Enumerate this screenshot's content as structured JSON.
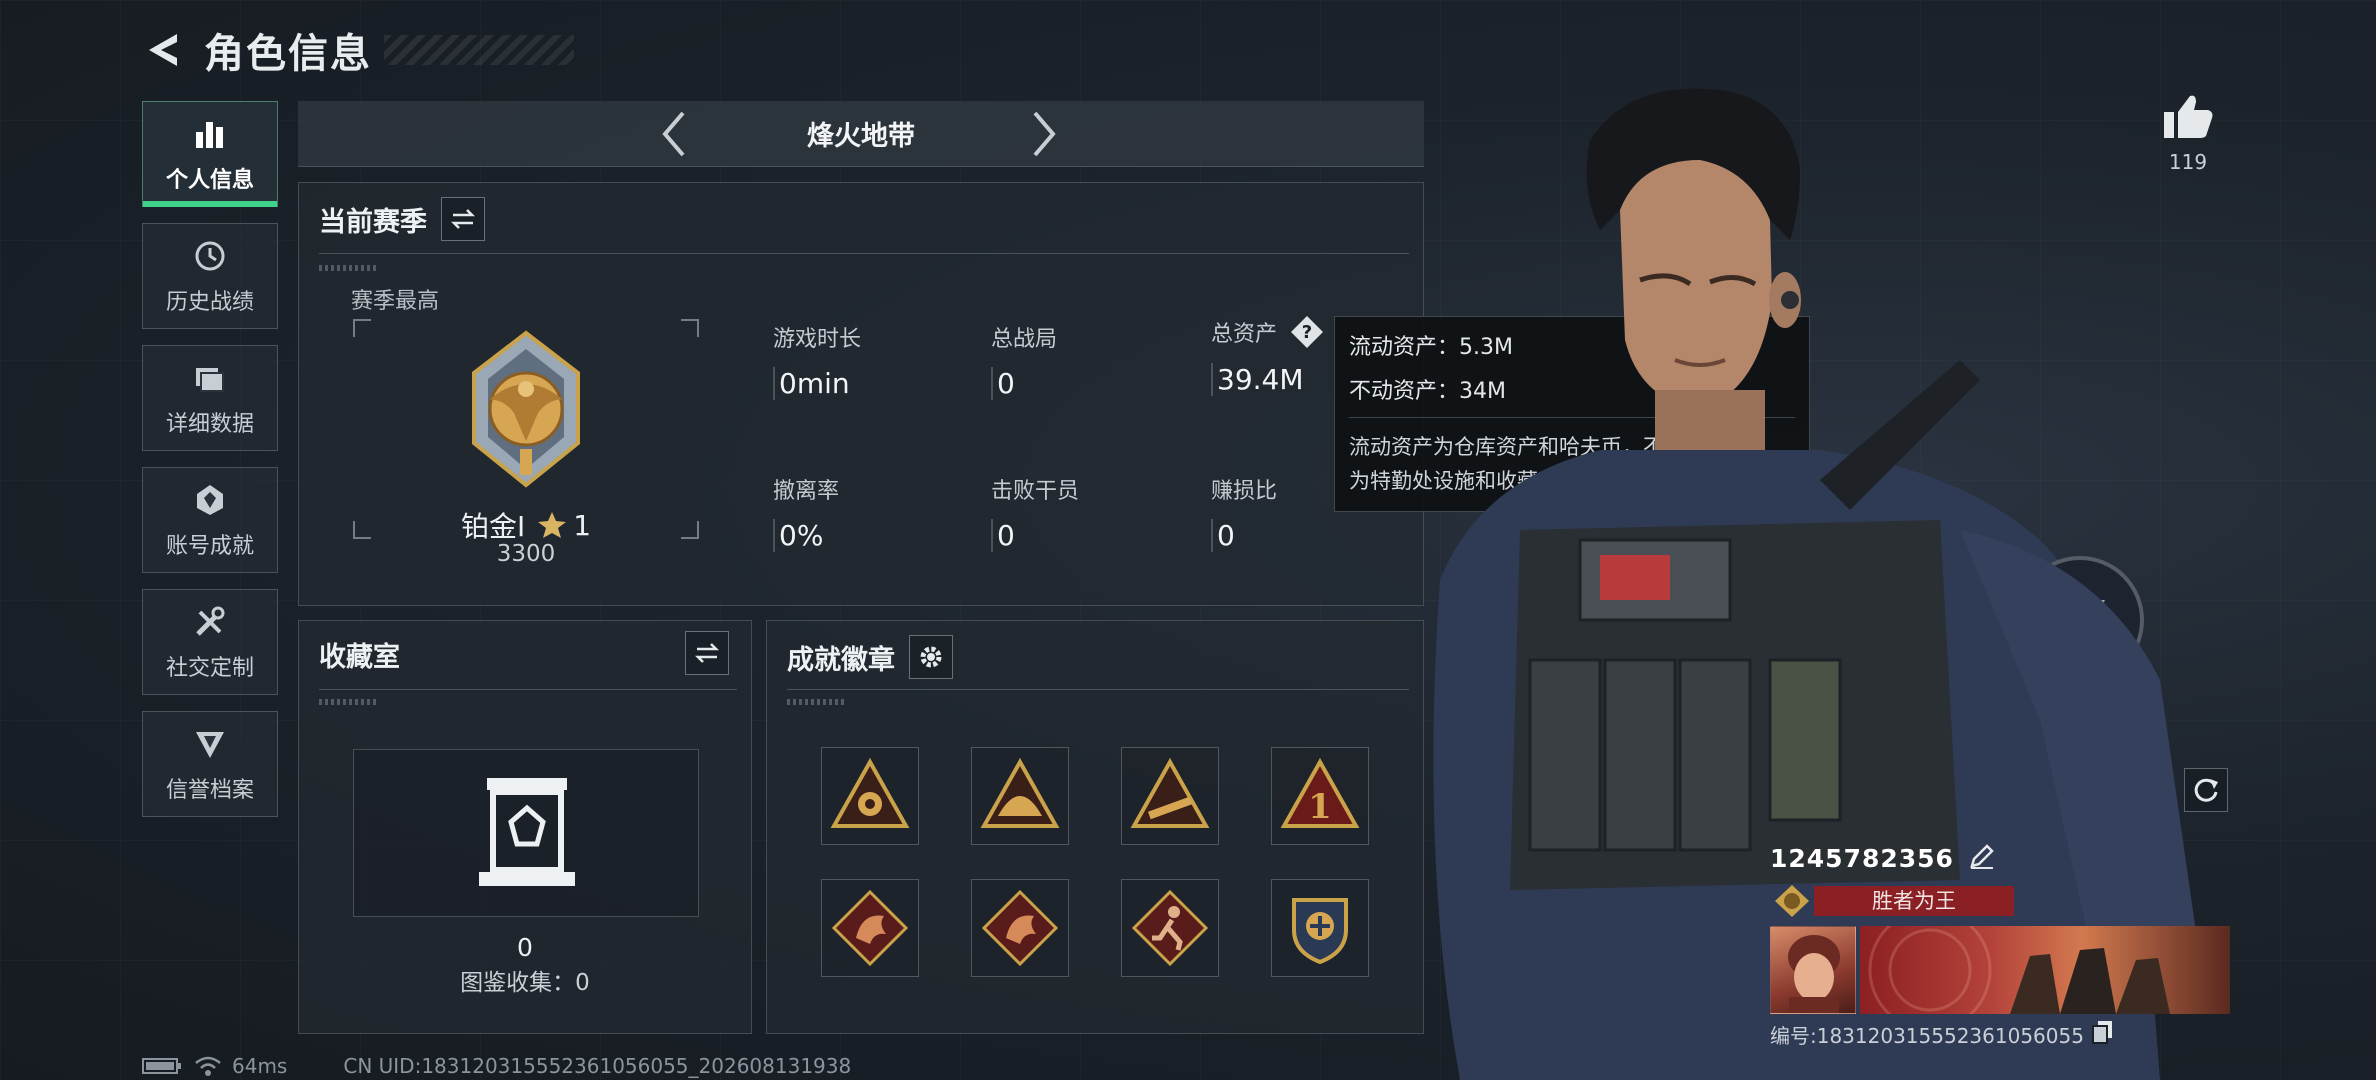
{
  "header": {
    "title": "角色信息"
  },
  "sidebar": {
    "items": [
      {
        "label": "个人信息",
        "icon": "bar-chart-icon",
        "active": true
      },
      {
        "label": "历史战绩",
        "icon": "history-icon",
        "active": false
      },
      {
        "label": "详细数据",
        "icon": "folder-icon",
        "active": false
      },
      {
        "label": "账号成就",
        "icon": "achievement-icon",
        "active": false
      },
      {
        "label": "社交定制",
        "icon": "tools-icon",
        "active": false
      },
      {
        "label": "信誉档案",
        "icon": "credit-shield-icon",
        "active": false
      }
    ]
  },
  "mode": {
    "name": "烽火地带"
  },
  "season": {
    "title": "当前赛季",
    "subtitle": "赛季最高",
    "rank_name": "铂金Ⅰ",
    "rank_stars": "1",
    "rank_score": "3300",
    "stats": [
      {
        "label": "游戏时长",
        "value": "0min"
      },
      {
        "label": "总战局",
        "value": "0"
      },
      {
        "label": "总资产",
        "value": "39.4M"
      },
      {
        "label": "撤离率",
        "value": "0%"
      },
      {
        "label": "击败干员",
        "value": "0"
      },
      {
        "label": "赚损比",
        "value": "0"
      }
    ]
  },
  "tooltip": {
    "liquid": "流动资产：5.3M",
    "fixed": "不动资产：34M",
    "desc_line1": "流动资产为仓库资产和哈夫币，不动资产",
    "desc_line2": "为特勤处设施和收藏室设施"
  },
  "collection": {
    "title": "收藏室",
    "count": "0",
    "catalog": "图鉴收集：0"
  },
  "badges": {
    "title": "成就徽章",
    "items": [
      "flower-badge-icon",
      "dome-badge-icon",
      "gun-badge-icon",
      "number-one-badge-icon",
      "dragon-badge-icon",
      "dragon-badge-icon",
      "runner-badge-icon",
      "shield-badge-icon"
    ]
  },
  "status": {
    "ping": "64ms",
    "uid": "CN UID:183120315552361056055_202608131938"
  },
  "player": {
    "likes": "119",
    "name": "1245782356",
    "title": "胜者为王",
    "id": "编号:183120315552361056055"
  },
  "colors": {
    "accent": "#3fd28a",
    "title_red": "#8a1f24",
    "background": "#1a2027"
  }
}
